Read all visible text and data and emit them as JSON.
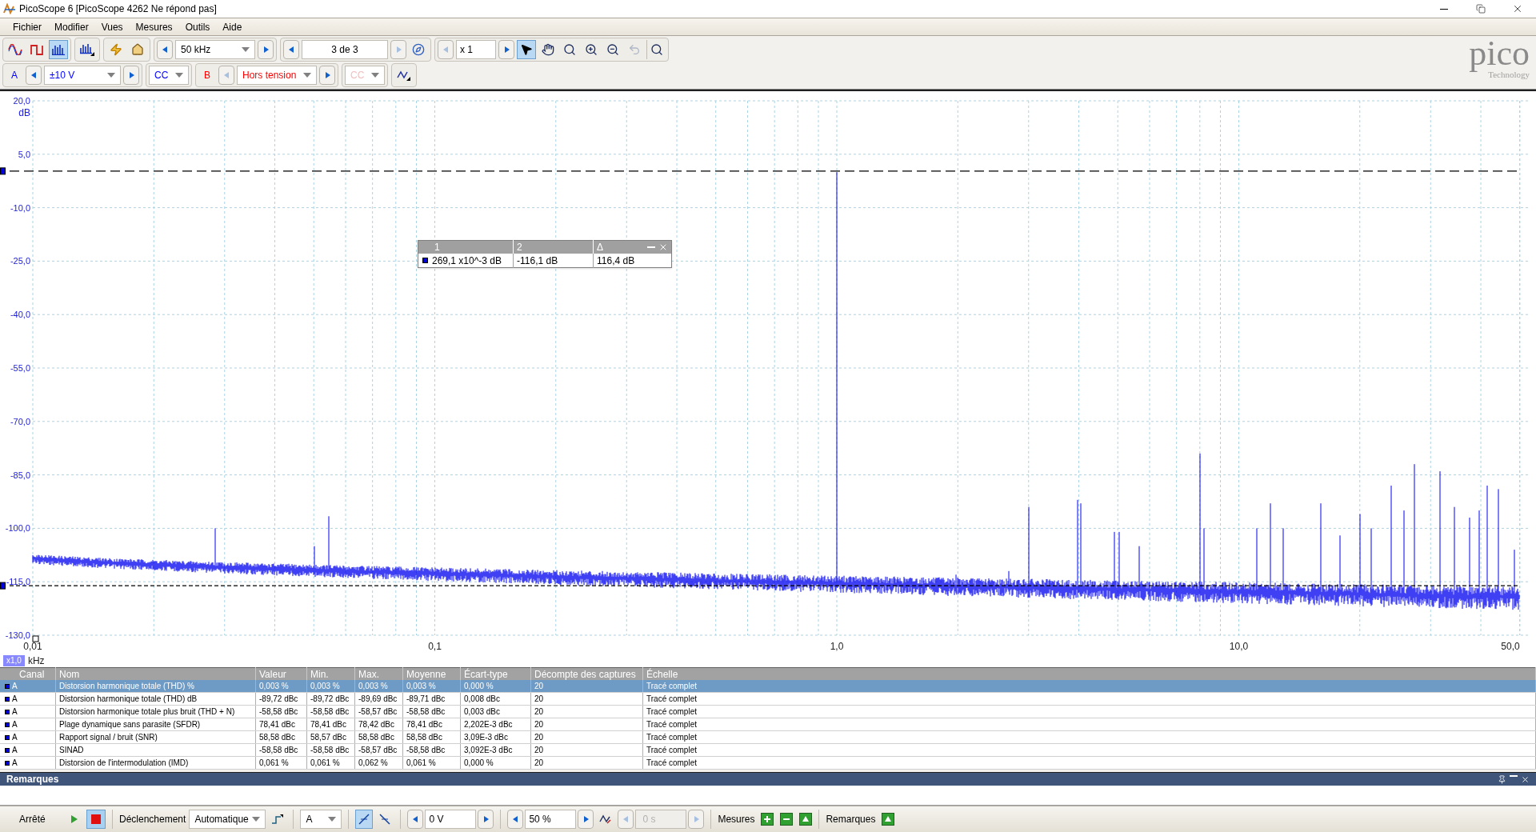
{
  "window": {
    "title": "PicoScope 6 [PicoScope 4262 Ne répond pas]"
  },
  "menu": [
    "Fichier",
    "Modifier",
    "Vues",
    "Mesures",
    "Outils",
    "Aide"
  ],
  "mode_buttons": [
    {
      "kind": "scope",
      "selected": false
    },
    {
      "kind": "persistence",
      "selected": false
    },
    {
      "kind": "spectrum",
      "selected": true
    },
    {
      "kind": "spectrum_options",
      "selected": false
    }
  ],
  "timebase": "50 kHz",
  "capture": "3 de 3",
  "zoom_factor": "x 1",
  "tools": [
    {
      "kind": "pointer",
      "selected": true,
      "disabled": false
    },
    {
      "kind": "hand",
      "selected": false,
      "disabled": false
    },
    {
      "kind": "zoom_area",
      "selected": false,
      "disabled": false
    },
    {
      "kind": "zoom_in",
      "selected": false,
      "disabled": false
    },
    {
      "kind": "zoom_out",
      "selected": false,
      "disabled": false
    },
    {
      "kind": "undo",
      "selected": false,
      "disabled": true
    }
  ],
  "logo": {
    "name": "pico",
    "tagline": "Technology"
  },
  "channels": [
    {
      "label": "A",
      "range": "±10 V",
      "coupling": "CC",
      "color": "#0000ff",
      "enabled": true
    },
    {
      "label": "B",
      "range": "Hors tension",
      "coupling": "CC",
      "color": "#ff0000",
      "enabled": false
    }
  ],
  "plot": {
    "y_labels": [
      "20,0",
      "5,0",
      "-10,0",
      "-25,0",
      "-40,0",
      "-55,0",
      "-70,0",
      "-85,0",
      "-100,0",
      "-115,0",
      "-130,0"
    ],
    "y_unit": "dB",
    "x_labels": [
      "0,01",
      "0,1",
      "1,0",
      "10,0",
      "50,0"
    ],
    "x_scale": "x1,0",
    "x_unit": "kHz",
    "cursor_readout": {
      "columns": [
        "1",
        "2",
        "Δ"
      ],
      "values": [
        "269,1 x10^-3 dB",
        "-116,1 dB",
        "116,4 dB"
      ]
    }
  },
  "measurements": {
    "columns": [
      "Canal",
      "Nom",
      "Valeur",
      "Min.",
      "Max.",
      "Moyenne",
      "Écart-type",
      "Décompte des captures",
      "Échelle"
    ],
    "rows": [
      {
        "selected": true,
        "cells": [
          "A",
          "Distorsion harmonique totale (THD) %",
          "0,003 %",
          "0,003 %",
          "0,003 %",
          "0,003 %",
          "0,000 %",
          "20",
          "Tracé complet"
        ]
      },
      {
        "selected": false,
        "cells": [
          "A",
          "Distorsion harmonique totale (THD) dB",
          "-89,72 dBc",
          "-89,72 dBc",
          "-89,69 dBc",
          "-89,71 dBc",
          "0,008 dBc",
          "20",
          "Tracé complet"
        ]
      },
      {
        "selected": false,
        "cells": [
          "A",
          "Distorsion harmonique totale plus bruit (THD + N)",
          "-58,58 dBc",
          "-58,58 dBc",
          "-58,57 dBc",
          "-58,58 dBc",
          "0,003 dBc",
          "20",
          "Tracé complet"
        ]
      },
      {
        "selected": false,
        "cells": [
          "A",
          "Plage dynamique sans parasite (SFDR)",
          "78,41 dBc",
          "78,41 dBc",
          "78,42 dBc",
          "78,41 dBc",
          "2,202E-3 dBc",
          "20",
          "Tracé complet"
        ]
      },
      {
        "selected": false,
        "cells": [
          "A",
          "Rapport signal / bruit (SNR)",
          "58,58 dBc",
          "58,57 dBc",
          "58,58 dBc",
          "58,58 dBc",
          "3,09E-3 dBc",
          "20",
          "Tracé complet"
        ]
      },
      {
        "selected": false,
        "cells": [
          "A",
          "SINAD",
          "-58,58 dBc",
          "-58,58 dBc",
          "-58,57 dBc",
          "-58,58 dBc",
          "3,092E-3 dBc",
          "20",
          "Tracé complet"
        ]
      },
      {
        "selected": false,
        "cells": [
          "A",
          "Distorsion de l'intermodulation (IMD)",
          "0,061 %",
          "0,061 %",
          "0,062 %",
          "0,061 %",
          "0,000 %",
          "20",
          "Tracé complet"
        ]
      }
    ]
  },
  "remarks": {
    "title": "Remarques"
  },
  "status_bar": {
    "run_state": "Arrêté",
    "trigger_label": "Déclenchement",
    "trigger_mode": "Automatique",
    "trigger_source": "A",
    "edges": [
      {
        "kind": "rising",
        "selected": true
      },
      {
        "kind": "falling",
        "selected": false
      }
    ],
    "threshold": "0 V",
    "pretrigger": "50 %",
    "delay": "0 s",
    "delay_disabled": true,
    "measures_label": "Mesures",
    "remarks_label": "Remarques"
  }
}
